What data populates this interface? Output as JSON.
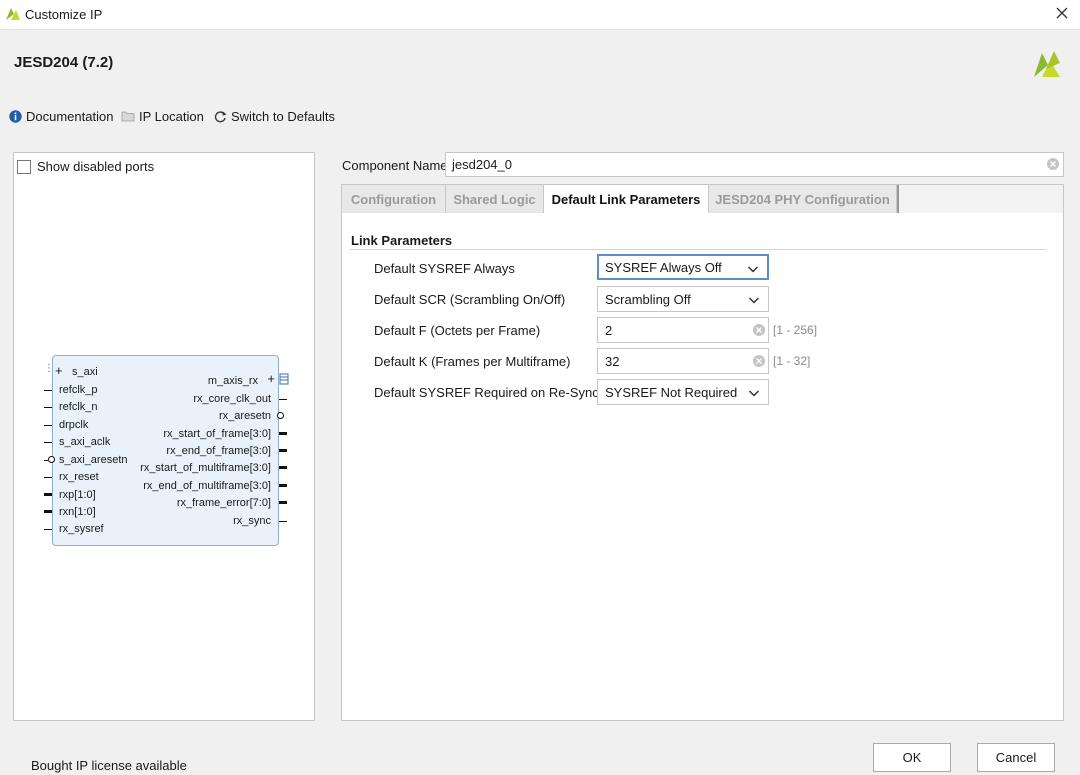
{
  "window": {
    "title": "Customize IP",
    "app_icon": "xilinx-logo-icon",
    "close_icon": "close-icon"
  },
  "ip": {
    "name": "JESD204 (7.2)",
    "brand_icon": "xilinx-brand-logo"
  },
  "toolbar": {
    "documentation": "Documentation",
    "ip_location": "IP Location",
    "switch_defaults": "Switch to Defaults"
  },
  "left_panel": {
    "show_disabled_ports": "Show disabled ports",
    "symbol": {
      "left_pins": [
        "s_axi",
        "refclk_p",
        "refclk_n",
        "drpclk",
        "s_axi_aclk",
        "s_axi_aresetn",
        "rx_reset",
        "rxp[1:0]",
        "rxn[1:0]",
        "rx_sysref"
      ],
      "right_pins": [
        "m_axis_rx",
        "rx_core_clk_out",
        "rx_aresetn",
        "rx_start_of_frame[3:0]",
        "rx_end_of_frame[3:0]",
        "rx_start_of_multiframe[3:0]",
        "rx_end_of_multiframe[3:0]",
        "rx_frame_error[7:0]",
        "rx_sync"
      ]
    }
  },
  "component": {
    "label": "Component Name",
    "value": "jesd204_0"
  },
  "tabs": [
    {
      "label": "Configuration",
      "active": false
    },
    {
      "label": "Shared Logic",
      "active": false
    },
    {
      "label": "Default Link Parameters",
      "active": true
    },
    {
      "label": "JESD204 PHY Configuration",
      "active": false
    }
  ],
  "link_params": {
    "title": "Link Parameters",
    "rows": [
      {
        "label": "Default SYSREF Always",
        "value": "SYSREF Always Off",
        "control": "dropdown"
      },
      {
        "label": "Default SCR (Scrambling On/Off)",
        "value": "Scrambling Off",
        "control": "dropdown"
      },
      {
        "label": "Default F (Octets per Frame)",
        "value": "2",
        "control": "text",
        "range": "[1 - 256]"
      },
      {
        "label": "Default K (Frames per Multiframe)",
        "value": "32",
        "control": "text",
        "range": "[1 - 32]"
      },
      {
        "label": "Default SYSREF Required on Re-Sync",
        "value": "SYSREF Not Required",
        "control": "dropdown"
      }
    ]
  },
  "footer": {
    "license": "Bought IP license available",
    "ok": "OK",
    "cancel": "Cancel"
  },
  "colors": {
    "symbol_fill": "#e9f2fa",
    "symbol_border": "#8fb0cc",
    "focus_border": "#5b8fc8",
    "info_blue": "#1f5fa8"
  }
}
